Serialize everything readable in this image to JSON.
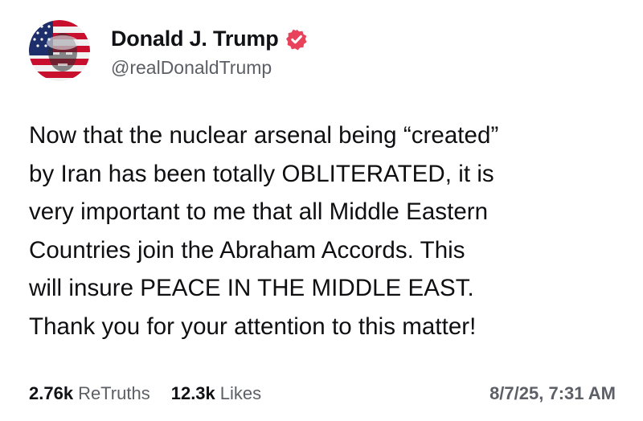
{
  "author": {
    "display_name": "Donald J. Trump",
    "handle": "@realDonaldTrump",
    "verified_icon": "verified-badge-icon",
    "avatar_icon": "profile-avatar"
  },
  "post": {
    "text": "Now that the nuclear arsenal being “created”\nby Iran has been totally OBLITERATED, it is\nvery important to me that all Middle Eastern\nCountries join the Abraham Accords. This\nwill insure PEACE IN THE MIDDLE EAST.\nThank you for your attention to this matter!"
  },
  "stats": {
    "retruths_count": "2.76k",
    "retruths_label": "ReTruths",
    "likes_count": "12.3k",
    "likes_label": "Likes",
    "timestamp": "8/7/25, 7:31 AM"
  },
  "colors": {
    "verified_badge": "#e8435b",
    "text_primary": "#0f0f12",
    "text_secondary": "#5d5f66"
  }
}
